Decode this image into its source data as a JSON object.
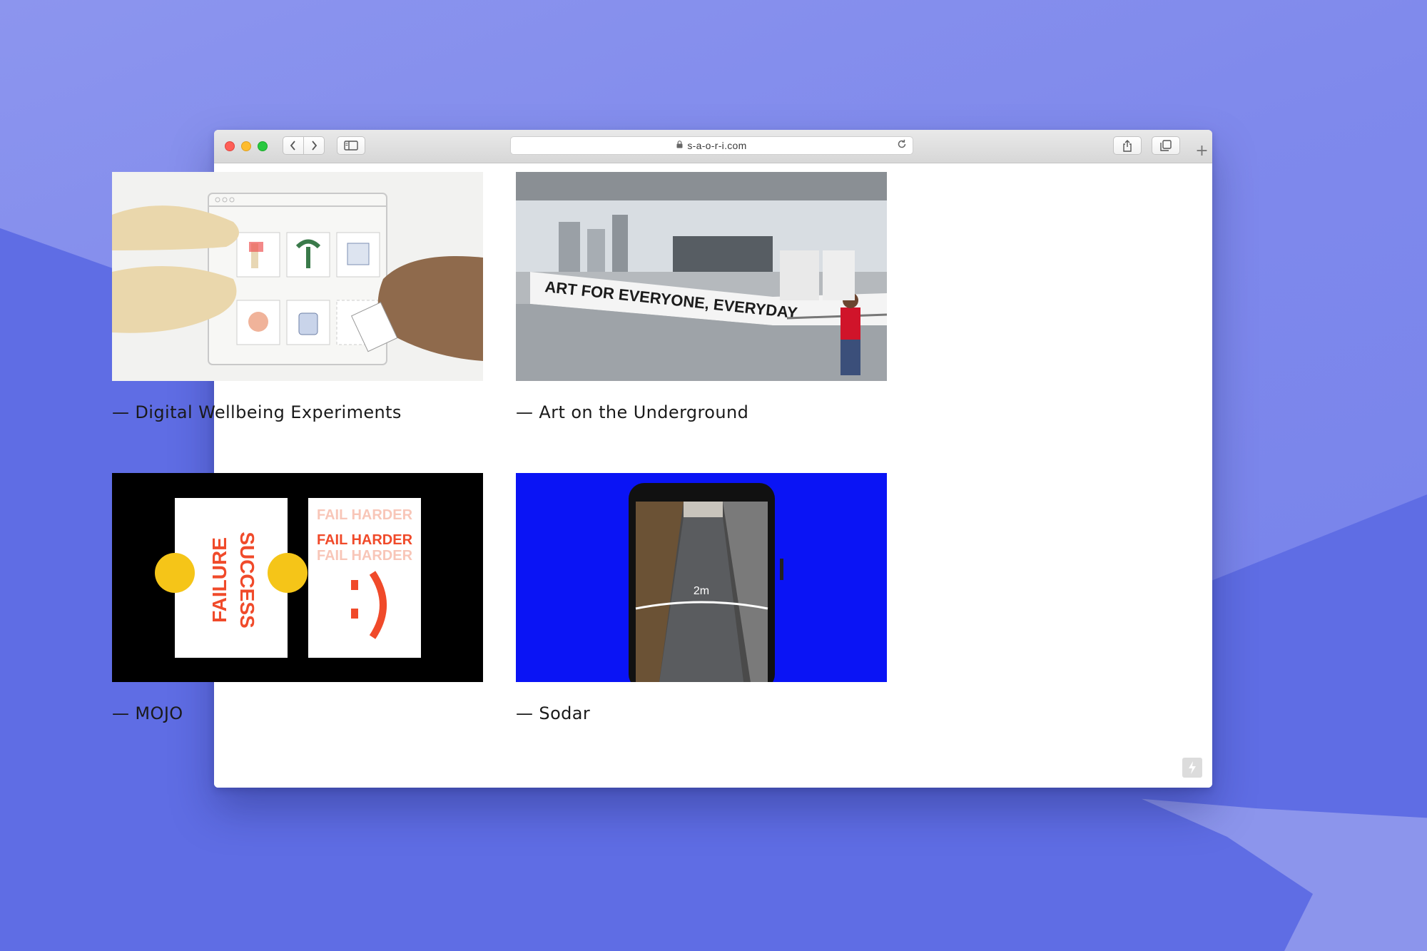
{
  "browser": {
    "url": "s-a-o-r-i.com",
    "back_icon": "chevron-left-icon",
    "forward_icon": "chevron-right-icon",
    "sidebar_icon": "sidebar-icon",
    "share_icon": "share-icon",
    "tabs_icon": "tabs-icon",
    "new_tab_label": "+"
  },
  "projects": [
    {
      "title": "— Digital Wellbeing Experiments"
    },
    {
      "title": "— Art on the Underground",
      "image_text": "ART FOR EVERYONE, EVERYDAY"
    },
    {
      "title": "— MOJO",
      "image_text_1": "FAILURE",
      "image_text_2": "SUCCESS",
      "image_text_3": "FAIL HARDER"
    },
    {
      "title": "— Sodar",
      "image_text": "2m"
    }
  ],
  "colors": {
    "background": "#6f7ce8",
    "sodar_blue": "#0a14f5",
    "mojo_black": "#000000",
    "mojo_red": "#f04a2a"
  }
}
